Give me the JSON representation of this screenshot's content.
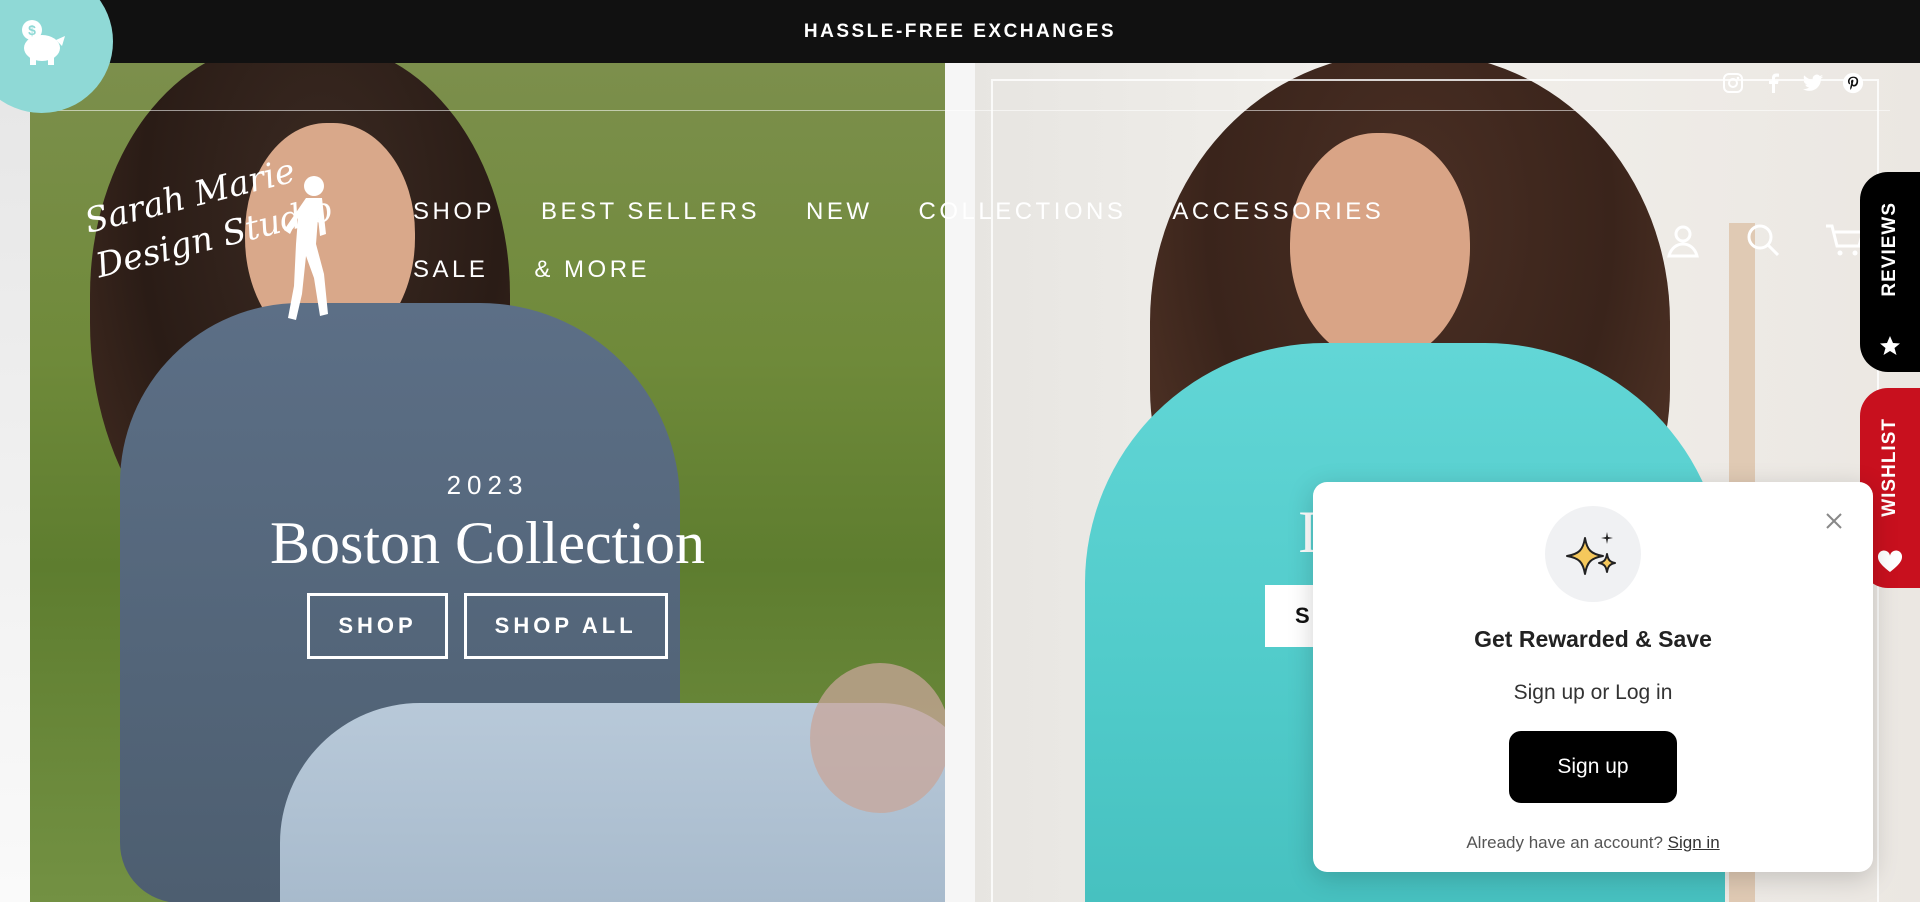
{
  "announcement": {
    "text": "HASSLE-FREE EXCHANGES"
  },
  "logo": {
    "line1": "Sarah Marie",
    "line2": "Design Studio"
  },
  "social": {
    "icons": [
      "instagram-icon",
      "facebook-icon",
      "twitter-icon",
      "pinterest-icon"
    ]
  },
  "nav": {
    "items": [
      {
        "label": "SHOP"
      },
      {
        "label": "BEST SELLERS"
      },
      {
        "label": "NEW"
      },
      {
        "label": "COLLECTIONS"
      },
      {
        "label": "ACCESSORIES"
      },
      {
        "label": "SALE"
      },
      {
        "label": "& MORE"
      }
    ]
  },
  "header_icons": [
    "account-icon",
    "search-icon",
    "cart-icon"
  ],
  "hero_left": {
    "eyebrow": "2023",
    "title": "Boston Collection",
    "btn_shop": "SHOP",
    "btn_shop_all": "SHOP ALL"
  },
  "hero_right": {
    "title_partial": "I",
    "btn_partial": "S"
  },
  "side_tabs": {
    "reviews": "REVIEWS",
    "wishlist": "WISHLIST"
  },
  "popup": {
    "title": "Get Rewarded & Save",
    "subtitle": "Sign up or Log in",
    "signup_button": "Sign up",
    "footer_text": "Already have an account?",
    "signin_link": "Sign in"
  },
  "colors": {
    "announce_bg": "#111111",
    "reward_bubble": "#8fd9d6",
    "reviews_tab": "#000000",
    "wishlist_tab": "#c8101e"
  }
}
